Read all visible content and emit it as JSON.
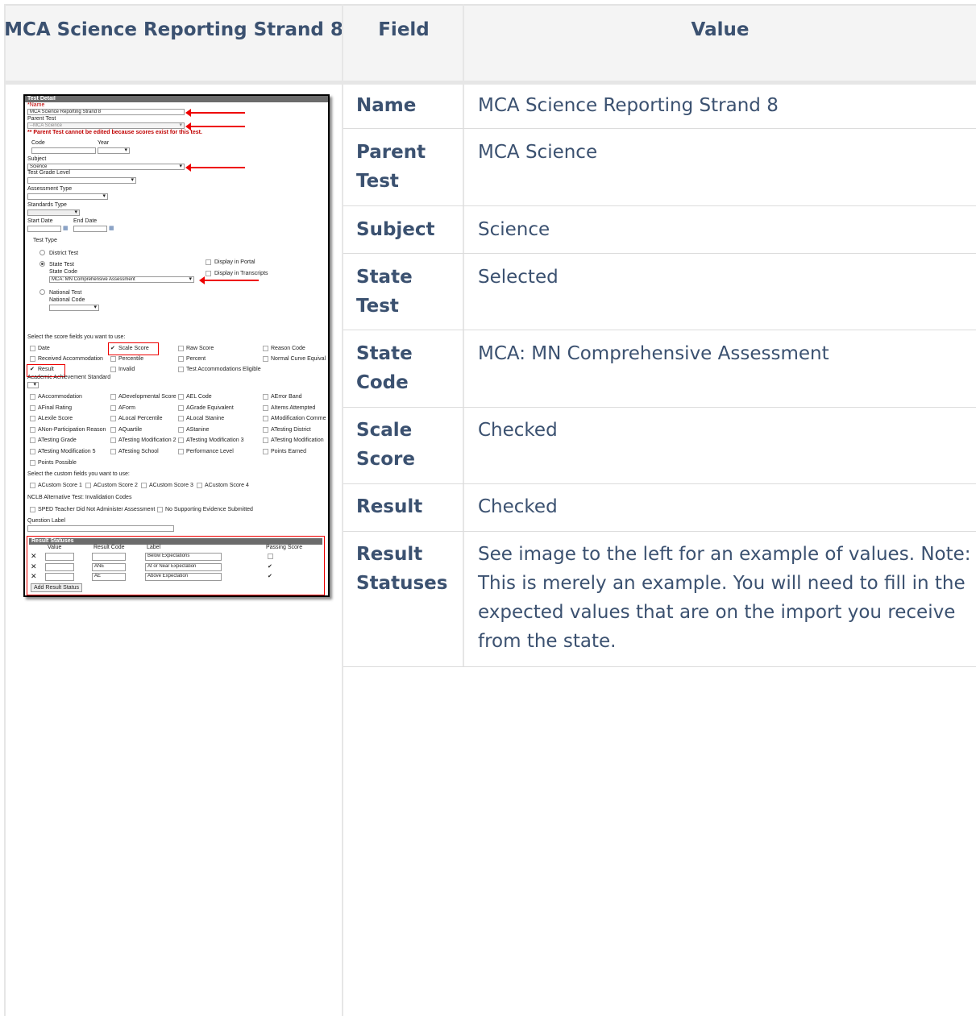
{
  "table": {
    "headers": [
      "MCA Science Reporting Strand 8",
      "Field",
      "Value"
    ],
    "rows": [
      {
        "field": "Name",
        "value": "MCA Science Reporting Strand 8"
      },
      {
        "field": "Parent Test",
        "value": "MCA Science"
      },
      {
        "field": "Subject",
        "value": "Science"
      },
      {
        "field": "State Test",
        "value": "Selected"
      },
      {
        "field": "State Code",
        "value": "MCA: MN Comprehensive Assessment"
      },
      {
        "field": "Scale Score",
        "value": "Checked"
      },
      {
        "field": "Result",
        "value": "Checked"
      },
      {
        "field": "Result Statuses",
        "value": "See image to the left for an example of values. Note: This is merely an example. You will need to fill in the expected values that are on the import you receive from the state."
      }
    ]
  },
  "screenshot": {
    "panel_title": "Test Detail",
    "name_label": "*Name",
    "name_value": "MCA Science Reporting Strand 8",
    "parent_test_label": "Parent Test",
    "parent_test_value": "--MCA Science",
    "parent_warning": "** Parent Test cannot be edited because scores exist for this test.",
    "code_label": "Code",
    "year_label": "Year",
    "subject_label": "Subject",
    "subject_value": "Science",
    "grade_label": "Test Grade Level",
    "assessment_type_label": "Assessment Type",
    "standards_type_label": "Standards Type",
    "start_date_label": "Start Date",
    "end_date_label": "End Date",
    "test_type_label": "Test Type",
    "district_test": "District Test",
    "state_test": "State Test",
    "state_code_label": "State Code",
    "state_code_value": "MCA: MN Comprehensive Assessment",
    "national_test": "National Test",
    "national_code_label": "National Code",
    "display_portal": "Display in Portal",
    "display_transcripts": "Display in Transcripts",
    "score_fields_label": "Select the score fields you want to use:",
    "score_fields": [
      {
        "label": "Date",
        "checked": false
      },
      {
        "label": "Scale Score",
        "checked": true
      },
      {
        "label": "Raw Score",
        "checked": false
      },
      {
        "label": "Reason Code",
        "checked": false
      },
      {
        "label": "Received Accommodation",
        "checked": false
      },
      {
        "label": "Percentile",
        "checked": false
      },
      {
        "label": "Percent",
        "checked": false
      },
      {
        "label": "Normal Curve Equival",
        "checked": false
      },
      {
        "label": "Result",
        "checked": true
      },
      {
        "label": "Invalid",
        "checked": false
      },
      {
        "label": "Test Accommodations Eligible",
        "checked": false
      }
    ],
    "achievement_label": "Academic Achievement Standard",
    "attribute_fields": [
      "AAccommodation",
      "ADevelopmental Score",
      "AEL Code",
      "AError Band",
      "AFinal Rating",
      "AForm",
      "AGrade Equivalent",
      "AItems Attempted",
      "ALexile Score",
      "ALocal Percentile",
      "ALocal Stanine",
      "AModification Comme",
      "ANon-Participation Reason",
      "AQuartile",
      "AStanine",
      "ATesting District",
      "ATesting Grade",
      "ATesting Modification 2",
      "ATesting Modification 3",
      "ATesting Modification",
      "ATesting Modification 5",
      "ATesting School",
      "Performance Level",
      "Points Earned",
      "Points Possible"
    ],
    "custom_fields_label": "Select the custom fields you want to use:",
    "custom_fields": [
      "ACustom Score 1",
      "ACustom Score 2",
      "ACustom Score 3",
      "ACustom Score 4"
    ],
    "nclb_label": "NCLB Alternative Test: Invalidation Codes",
    "nclb_fields": [
      "SPED Teacher Did Not Administer Assessment",
      "No Supporting Evidence Submitted"
    ],
    "question_label": "Question Label",
    "result_statuses_title": "Result Statuses",
    "rs_columns": [
      "Value",
      "Result Code",
      "Label",
      "Passing Score"
    ],
    "rs_rows": [
      {
        "value": "",
        "code": "",
        "label": "Below Expectations",
        "passing": false
      },
      {
        "value": "",
        "code": "ANE",
        "label": "At or Near Expectation",
        "passing": true
      },
      {
        "value": "",
        "code": "AE",
        "label": "Above Expectation",
        "passing": true
      }
    ],
    "add_button": "Add Result Status"
  }
}
